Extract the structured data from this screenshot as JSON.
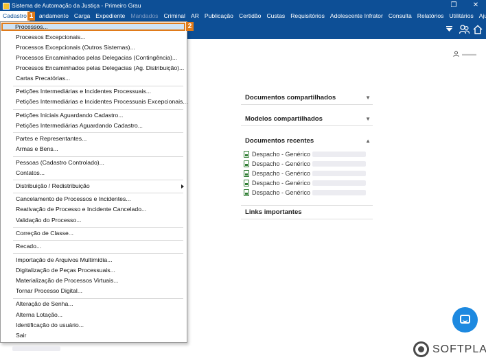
{
  "window": {
    "title": "Sistema de Automação da Justiça - Primeiro Grau",
    "restore_glyph": "❐",
    "close_glyph": "✕"
  },
  "menubar": {
    "items": [
      "Cadastro",
      "andamento",
      "Carga",
      "Expediente",
      "Mandados",
      "Criminal",
      "AR",
      "Publicação",
      "Certidão",
      "Custas",
      "Requisitórios",
      "Adolescente Infrator",
      "Consulta",
      "Relatórios",
      "Utilitários",
      "Ajuda"
    ],
    "disabled_item": "Mandados"
  },
  "toolbar": {
    "icons": [
      "caret-down-icon",
      "users-icon",
      "home-icon"
    ]
  },
  "dropdown": {
    "items": [
      "Processos...",
      "Processos Excepcionais...",
      "Processos Excepcionais (Outros Sistemas)...",
      "Processos Encaminhados pelas Delegacias (Contingência)...",
      "Processos Encaminhados pelas Delegacias (Ag. Distribuição)...",
      "Cartas Precatórias...",
      "Petições Intermediárias e Incidentes Processuais...",
      "Petições Intermediárias e Incidentes Processuais Excepcionais...",
      "Petições Iniciais Aguardando Cadastro...",
      "Petições Intermediárias Aguardando Cadastro...",
      "Partes e Representantes...",
      "Armas e Bens...",
      "Pessoas (Cadastro Controlado)...",
      "Contatos...",
      "Distribuição / Redistribuição",
      "Cancelamento de Processos e Incidentes...",
      "Reativação de Processo e Incidente Cancelado...",
      "Validação do Processo...",
      "Correção de Classe...",
      "Recado...",
      "Importação de Arquivos Multimídia...",
      "Digitalização de Peças Processuais...",
      "Materialização de Processos Virtuais...",
      "Tornar Processo Digital...",
      "Alteração de Senha...",
      "Alterna Lotação...",
      "Identificação do usuário...",
      "Sair"
    ]
  },
  "callouts": {
    "one": "1",
    "two": "2"
  },
  "panels": {
    "shared_docs": "Documentos compartilhados",
    "shared_models": "Modelos compartilhados",
    "recent_docs": "Documentos recentes",
    "recent_items": [
      "Despacho - Genérico",
      "Despacho - Genérico",
      "Despacho - Genérico",
      "Despacho - Genérico",
      "Despacho - Genérico"
    ],
    "links": "Links importantes"
  },
  "brand": {
    "name": "SOFTPLAN"
  },
  "colors": {
    "primary": "#0d4f96",
    "highlight": "#e07b1a",
    "chat": "#1d89e0"
  }
}
